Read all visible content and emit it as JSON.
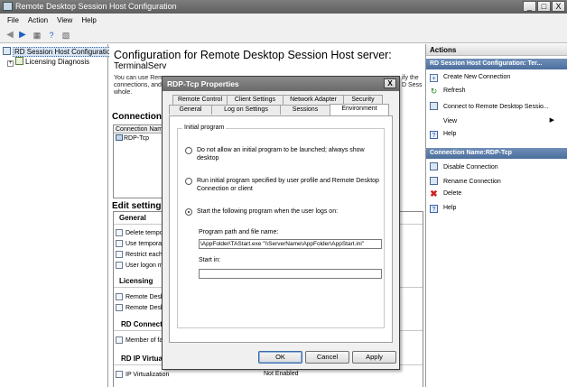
{
  "window": {
    "title": "Remote Desktop Session Host Configuration",
    "min": "_",
    "max": "□",
    "close": "X"
  },
  "menu": [
    "File",
    "Action",
    "View",
    "Help"
  ],
  "tree": {
    "root": "RD Session Host Configuration:",
    "child": "Licensing Diagnosis"
  },
  "center": {
    "title": "Configuration for Remote Desktop Session Host server:",
    "server": "TerminalServ",
    "desc_lines": [
      "You can use Remo",
      "connections, and c",
      "whole."
    ],
    "desc_tail": [
      "ify the",
      "D Sess"
    ],
    "connections_heading": "Connections",
    "conn_col": "Connection Nam",
    "conn_row": "RDP-Tcp",
    "edit_heading": "Edit settings",
    "general_heading": "General",
    "general_items": [
      "Delete tempor",
      "Use temporar",
      "Restrict each",
      "User logon m"
    ],
    "licensing_heading": "Licensing",
    "licensing_items": [
      "Remote Desk",
      "Remote Desk"
    ],
    "rd_connection_heading": "RD Connectio",
    "rd_connection_items": [
      "Member of far"
    ],
    "rd_ip_heading": "RD IP Virtuali",
    "rd_ip_item": "IP Virtualization",
    "rd_ip_value": "Not Enabled"
  },
  "actions": {
    "title": "Actions",
    "band1": "RD Session Host Configuration: Ter...",
    "items1": [
      "Create New Connection",
      "Refresh",
      "Connect to Remote Desktop Sessio...",
      "View",
      "Help"
    ],
    "band2": "Connection Name:RDP-Tcp",
    "items2": [
      "Disable Connection",
      "Rename Connection",
      "Delete",
      "Help"
    ]
  },
  "dialog": {
    "title": "RDP-Tcp Properties",
    "close": "X",
    "tabs_row1": [
      "Remote Control",
      "Client Settings",
      "Network Adapter",
      "Security"
    ],
    "tabs_row2": [
      "General",
      "Log on Settings",
      "Sessions",
      "Environment"
    ],
    "active_tab": "Environment",
    "group_legend": "Initial program",
    "option1_line1": "Do not allow an initial program to be launched; always show",
    "option1_line2": "desktop",
    "option2_line1": "Run initial program specified by user profile and Remote Desktop",
    "option2_line2": "Connection or client",
    "option3": "Start the following program when the user logs on:",
    "selected_option": 3,
    "path_label": "Program path and file name:",
    "path_value": "\\AppFolder\\TAStart.exe \"\\\\ServerName\\AppFolder\\AppStart.ini\"",
    "start_label": "Start in:",
    "start_value": "",
    "ok": "OK",
    "cancel": "Cancel",
    "apply": "Apply"
  },
  "colors": {
    "band": "#4b6e9d",
    "titlebar": "#6a6a6a",
    "delete_red": "#cc1f1f"
  }
}
